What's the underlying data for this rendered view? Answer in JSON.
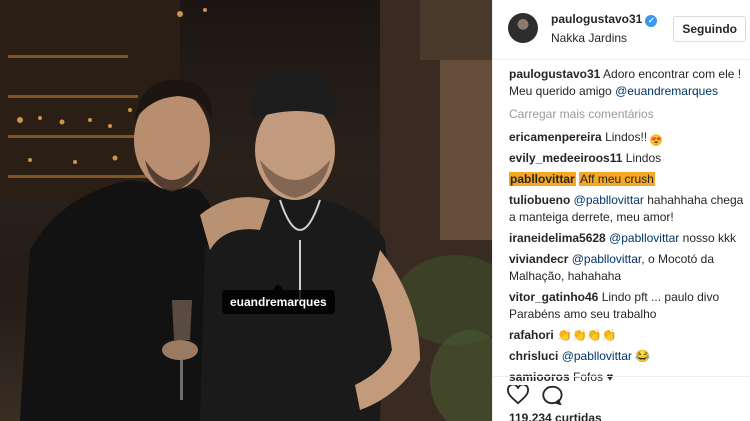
{
  "post": {
    "tag_label": "euandremarques"
  },
  "header": {
    "username": "paulogustavo31",
    "verified_icon": "✓",
    "location": "Nakka Jardins",
    "follow_label": "Seguindo"
  },
  "caption": {
    "username": "paulogustavo31",
    "text": "Adoro encontrar com ele ! Meu querido amigo",
    "mention": "@euandremarques"
  },
  "load_more": "Carregar mais comentários",
  "comments": [
    {
      "user": "ericamenpereira",
      "text": "Lindos!!",
      "emoji": "😍"
    },
    {
      "user": "evily_medeeiroos11",
      "text": "Lindos"
    },
    {
      "user": "pabllovittar",
      "text": "Aff meu crush"
    },
    {
      "user": "tuliobueno",
      "mention": "@pabllovittar",
      "text": "hahahhaha chega a manteiga derrete, meu amor!"
    },
    {
      "user": "iraneidelima5628",
      "mention": "@pabllovittar",
      "text": "nosso kkk"
    },
    {
      "user": "viviandecr",
      "mention": "@pabllovittar",
      "text": ", o Mocotó da Malhação, hahahaha"
    },
    {
      "user": "vitor_gatinho46",
      "text": "Lindo pft ... paulo divo Parabéns amo seu trabalho"
    },
    {
      "user": "rafahori",
      "emoji": "👏👏👏👏"
    },
    {
      "user": "chrisluci",
      "mention": "@pabllovittar",
      "emoji": "😂"
    },
    {
      "user": "samiooros",
      "text": "Fofos ♥"
    }
  ],
  "actions": {
    "like_icon": "heart-outline",
    "comment_icon": "speech-bubble",
    "likes_text": "119.234 curtidas"
  },
  "colors": {
    "mention": "#003569",
    "highlight": "#f5a623",
    "verified": "#3897f0"
  }
}
